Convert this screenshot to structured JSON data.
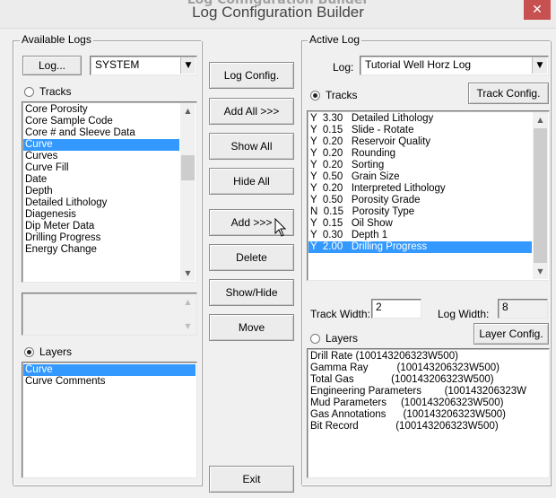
{
  "window": {
    "title": "Log Configuration Builder",
    "title_cut_text": "Log Configuration Builder",
    "close_glyph": "✕"
  },
  "available_logs": {
    "group_label": "Available Logs",
    "log_button": "Log...",
    "log_combo_value": "SYSTEM",
    "tracks_radio_label": "Tracks",
    "tracks_selected": false,
    "tracks_list": [
      "Core Porosity",
      "Core Sample Code",
      "Core # and Sleeve Data",
      "Curve",
      "Curves",
      "Curve Fill",
      "Date",
      "Depth",
      "Detailed Lithology",
      "Diagenesis",
      "Dip Meter Data",
      "Drilling Progress",
      "Energy Change"
    ],
    "tracks_selected_index": 3,
    "layers_radio_label": "Layers",
    "layers_selected": true,
    "layers_list": [
      "Curve",
      "Curve Comments"
    ],
    "layers_selected_index": 0
  },
  "middle_buttons": {
    "log_config": "Log Config.",
    "add_all": "Add All >>>",
    "show_all": "Show All",
    "hide_all": "Hide All",
    "add": "Add >>>",
    "delete": "Delete",
    "show_hide": "Show/Hide",
    "move": "Move",
    "exit": "Exit"
  },
  "active_log": {
    "group_label": "Active Log",
    "log_label": "Log:",
    "log_combo_value": "Tutorial Well Horz Log",
    "tracks_radio_label": "Tracks",
    "tracks_selected": true,
    "track_config_button": "Track Config.",
    "tracks_list": [
      "Y  3.30   Detailed Lithology",
      "Y  0.15   Slide - Rotate",
      "Y  0.20   Reservoir Quality",
      "Y  0.20   Rounding",
      "Y  0.20   Sorting",
      "Y  0.50   Grain Size",
      "Y  0.20   Interpreted Lithology",
      "Y  0.50   Porosity Grade",
      "N  0.15   Porosity Type",
      "Y  0.15   Oil Show",
      "Y  0.30   Depth 1",
      "Y  2.00   Drilling Progress"
    ],
    "tracks_selected_index": 11,
    "track_width_label": "Track Width:",
    "track_width_value": "2",
    "log_width_label": "Log Width:",
    "log_width_value": "8",
    "layers_radio_label": "Layers",
    "layers_selected": false,
    "layer_config_button": "Layer Config.",
    "layers_list": [
      "Drill Rate (100143206323W500)",
      "Gamma Ray          (100143206323W500)",
      "Total Gas             (100143206323W500)",
      "Engineering Parameters        (100143206323W",
      "Mud Parameters     (100143206323W500)",
      "Gas Annotations      (100143206323W500)",
      "Bit Record             (100143206323W500)"
    ]
  },
  "icons": {
    "close": "close-icon",
    "dropdown": "chevron-down-icon",
    "scroll_up": "scroll-up-arrow-icon",
    "scroll_down": "scroll-down-arrow-icon",
    "cursor": "mouse-pointer-icon"
  }
}
